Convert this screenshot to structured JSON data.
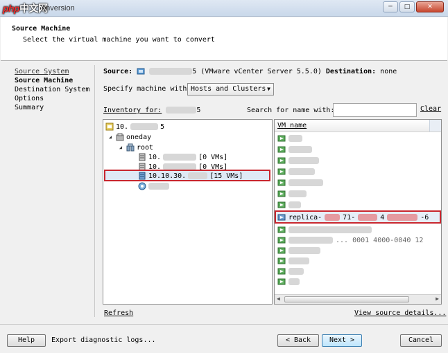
{
  "titlebar": {
    "logo": "php",
    "logo_suffix": "中文网",
    "title_visible": "onversion",
    "buttons": [
      "─",
      "□",
      "✕"
    ]
  },
  "header": {
    "title": "Source Machine",
    "subtitle": "Select the virtual machine you want to convert"
  },
  "nav": {
    "items": [
      {
        "label": "Source System",
        "state": "link"
      },
      {
        "label": "Source Machine",
        "state": "active"
      },
      {
        "label": "Destination System",
        "state": "normal"
      },
      {
        "label": "Options",
        "state": "normal"
      },
      {
        "label": "Summary",
        "state": "normal"
      }
    ]
  },
  "main": {
    "source_label": "Source:",
    "source_value": "5 (VMware vCenter Server 5.5.0)",
    "destination_label": "Destination:",
    "destination_value": "none",
    "specify_label": "Specify machine with:",
    "specify_value": "Hosts and Clusters",
    "inventory_label": "Inventory for:",
    "inventory_suffix": "5",
    "search_label": "Search for name with:",
    "search_value": "",
    "clear_label": "Clear",
    "tree": {
      "root_label": "10.",
      "root_suffix": "5",
      "datacenter": "oneday",
      "cluster": "root",
      "hosts": [
        {
          "name": "10.",
          "vms": "[0 VMs]"
        },
        {
          "name": "10.",
          "vms": "[0 VMs]"
        },
        {
          "name": "10.10.30.",
          "vms": "[15 VMs]"
        }
      ]
    },
    "vm_list": {
      "column_header": "VM name",
      "selected_vm": "replica-",
      "selected_vm_parts": [
        "71-",
        "4",
        "-6"
      ],
      "partial_text": "... 0001 4000-0040 12"
    },
    "refresh_label": "Refresh",
    "view_details_label": "View source details..."
  },
  "footer": {
    "help_label": "Help",
    "export_label": "Export diagnostic logs...",
    "back_label": "< Back",
    "next_label": "Next >",
    "cancel_label": "Cancel"
  }
}
